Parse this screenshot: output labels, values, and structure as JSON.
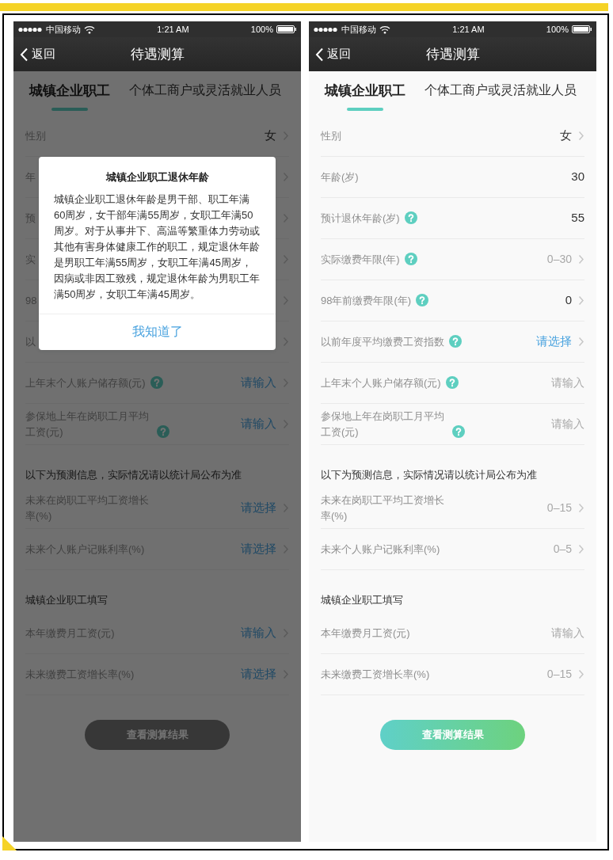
{
  "screens": [
    {
      "dimmed": true,
      "status_bar": {
        "carrier": "中国移动",
        "time": "1:21 AM",
        "battery": "100%"
      },
      "nav": {
        "back": "返回",
        "title": "待遇测算"
      },
      "tabs": [
        {
          "label": "城镇企业职工",
          "selected": true
        },
        {
          "label": "个体工商户或灵活就业人员",
          "selected": false
        }
      ],
      "rows": [
        {
          "kind": "field",
          "label": "性别",
          "help": false,
          "value": "女",
          "chevron": true
        },
        {
          "kind": "field",
          "label": "年",
          "help": false,
          "chevron": true
        },
        {
          "kind": "field",
          "label": "预",
          "help": false,
          "chevron": true
        },
        {
          "kind": "field",
          "label": "实",
          "help": false,
          "chevron": true
        },
        {
          "kind": "field",
          "label": "98",
          "help": false,
          "chevron": true
        },
        {
          "kind": "field",
          "label": "以",
          "help": false,
          "chevron": true
        },
        {
          "kind": "field",
          "label": "上年末个人账户储存额(元)",
          "help": true,
          "prompt": "请输入",
          "chevron": true
        },
        {
          "kind": "field",
          "label": "参保地上年在岗职工月平均工资(元)",
          "help": true,
          "prompt": "请输入",
          "chevron": true
        },
        {
          "kind": "heading",
          "label": "以下为预测信息，实际情况请以统计局公布为准"
        },
        {
          "kind": "field",
          "label": "未来在岗职工平均工资增长率(%)",
          "help": false,
          "prompt": "请选择",
          "chevron": true
        },
        {
          "kind": "field",
          "label": "未来个人账户记账利率(%)",
          "help": false,
          "prompt": "请选择",
          "chevron": true
        },
        {
          "kind": "heading",
          "label": "城镇企业职工填写"
        },
        {
          "kind": "field",
          "label": "本年缴费月工资(元)",
          "help": false,
          "prompt": "请输入",
          "chevron": true
        },
        {
          "kind": "field",
          "label": "未来缴费工资增长率(%)",
          "help": false,
          "prompt": "请选择",
          "chevron": true
        }
      ],
      "submit": {
        "label": "查看测算结果",
        "disabled": true
      },
      "dialog": {
        "title": "城镇企业职工退休年龄",
        "body": "城镇企业职工退休年龄是男干部、职工年满60周岁，女干部年满55周岁，女职工年满50周岁。对于从事井下、高温等繁重体力劳动或其他有害身体健康工作的职工，规定退休年龄是男职工年满55周岁，女职工年满45周岁，因病或非因工致残，规定退休年龄为男职工年满50周岁，女职工年满45周岁。",
        "button": "我知道了"
      }
    },
    {
      "dimmed": false,
      "status_bar": {
        "carrier": "中国移动",
        "time": "1:21 AM",
        "battery": "100%"
      },
      "nav": {
        "back": "返回",
        "title": "待遇测算"
      },
      "tabs": [
        {
          "label": "城镇企业职工",
          "selected": true
        },
        {
          "label": "个体工商户或灵活就业人员",
          "selected": false
        }
      ],
      "rows": [
        {
          "kind": "field",
          "label": "性别",
          "help": false,
          "value": "女",
          "chevron": true
        },
        {
          "kind": "field",
          "label": "年龄(岁)",
          "help": false,
          "value": "30",
          "chevron": false
        },
        {
          "kind": "field",
          "label": "预计退休年龄(岁)",
          "help": true,
          "value": "55",
          "chevron": false
        },
        {
          "kind": "field",
          "label": "实际缴费年限(年)",
          "help": true,
          "placeholder": "0–30",
          "chevron": true
        },
        {
          "kind": "field",
          "label": "98年前缴费年限(年)",
          "help": true,
          "value": "0",
          "chevron": true
        },
        {
          "kind": "field",
          "label": "以前年度平均缴费工资指数",
          "help": true,
          "prompt": "请选择",
          "chevron": true
        },
        {
          "kind": "field",
          "label": "上年末个人账户储存额(元)",
          "help": true,
          "placeholder": "请输入",
          "chevron": false
        },
        {
          "kind": "field",
          "label": "参保地上年在岗职工月平均工资(元)",
          "help": true,
          "placeholder": "请输入",
          "chevron": false
        },
        {
          "kind": "heading",
          "label": "以下为预测信息，实际情况请以统计局公布为准"
        },
        {
          "kind": "field",
          "label": "未来在岗职工平均工资增长率(%)",
          "help": false,
          "placeholder": "0–15",
          "chevron": true
        },
        {
          "kind": "field",
          "label": "未来个人账户记账利率(%)",
          "help": false,
          "placeholder": "0–5",
          "chevron": true
        },
        {
          "kind": "heading",
          "label": "城镇企业职工填写"
        },
        {
          "kind": "field",
          "label": "本年缴费月工资(元)",
          "help": false,
          "placeholder": "请输入",
          "chevron": false
        },
        {
          "kind": "field",
          "label": "未来缴费工资增长率(%)",
          "help": false,
          "placeholder": "0–15",
          "chevron": true
        }
      ],
      "submit": {
        "label": "查看测算结果",
        "disabled": false
      }
    }
  ]
}
